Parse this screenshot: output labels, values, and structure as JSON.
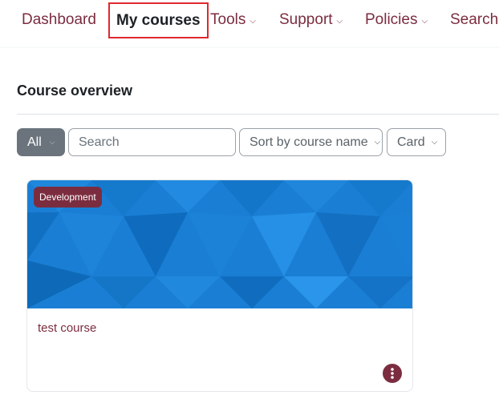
{
  "nav": {
    "dashboard": "Dashboard",
    "my_courses": "My courses",
    "tools": "Tools",
    "support": "Support",
    "policies": "Policies",
    "search": "Search"
  },
  "overview": {
    "title": "Course overview",
    "filter_all": "All",
    "search_placeholder": "Search",
    "sort_label": "Sort by course name",
    "view_label": "Card"
  },
  "courses": [
    {
      "category": "Development",
      "name": "test course"
    }
  ],
  "colors": {
    "brand": "#7b2d3f",
    "highlight_border": "#e0282e",
    "course_image": "#1a7fd4"
  }
}
